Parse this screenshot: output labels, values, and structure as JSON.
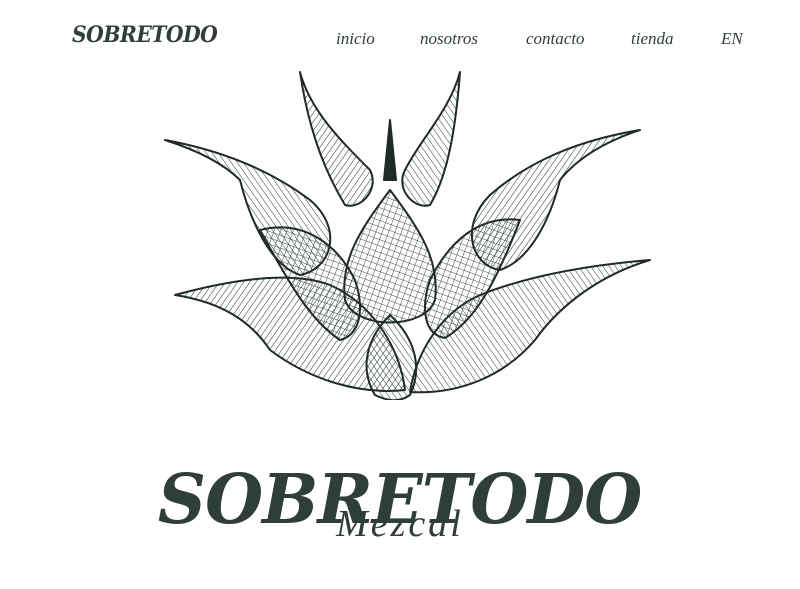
{
  "header": {
    "brand": "SOBRETODO",
    "nav": [
      {
        "label": "inicio"
      },
      {
        "label": "nosotros"
      },
      {
        "label": "contacto"
      },
      {
        "label": "tienda"
      },
      {
        "label": "EN"
      }
    ]
  },
  "hero": {
    "illustration": "agave-icon",
    "title": "SOBRETODO",
    "subtitle": "Mezcal"
  },
  "colors": {
    "ink": "#2f3f38",
    "background": "#ffffff"
  }
}
